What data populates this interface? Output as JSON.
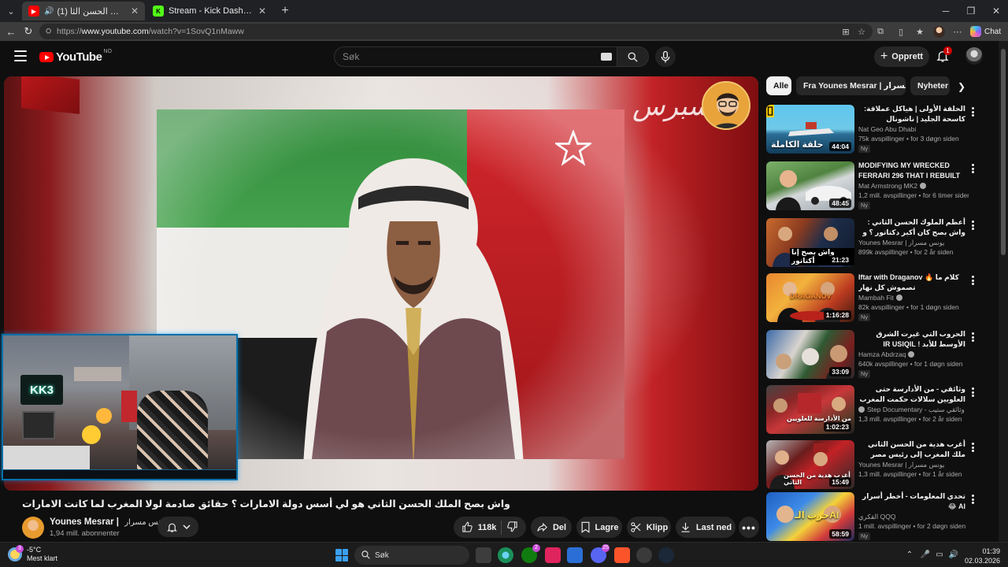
{
  "browser": {
    "tabs": [
      {
        "title": "(1) واش بصح الملك الحسن الثا...",
        "active": true
      },
      {
        "title": "Stream - Kick Dashboard",
        "active": false
      }
    ],
    "url_prefix": "https://",
    "url_host": "www.youtube.com",
    "url_path": "/watch?v=1SovQ1nMaww",
    "copilot_label": "Chat"
  },
  "header": {
    "logo_text": "YouTube",
    "region": "NO",
    "search_placeholder": "Søk",
    "create_label": "Opprett",
    "notification_count": "1"
  },
  "player": {
    "channel_watermark": "سبرس",
    "webcam_sign": "KK3"
  },
  "video": {
    "title": "واش بصح الملك الحسن الثاني هو لي أسس دولة الامارات ؟ حقائق صادمة لولا المغرب لما كانت الامارات",
    "channel_name": "Younes Mesrar |",
    "channel_name_ar": "يونس مسرار",
    "subscribers": "1,94 mill. abonnenter",
    "likes": "118k",
    "share_label": "Del",
    "save_label": "Lagre",
    "clip_label": "Klipp",
    "download_label": "Last ned"
  },
  "chips": [
    "Alle",
    "Fra Younes Mesrar | يونس مسرار",
    "Nyheter fr"
  ],
  "recommendations": [
    {
      "title": "الحلقة الأولى | هياكل عملاقة: كاسحة الجليد | ناشونال جيوغرافيك أبوظبي",
      "channel": "Nat Geo Abu Dhabi",
      "meta": "75k avspillinger • for 3 døgn siden",
      "duration": "44:04",
      "new": "Ny",
      "overlay": "حلقة الكاملة"
    },
    {
      "title": "MODIFYING MY WRECKED FERRARI 296 THAT I REBUILT",
      "channel": "Mat Armstrong MK2",
      "meta": "1,2 mill. avspillinger • for 6 timer siden",
      "duration": "48:45",
      "new": "Ny",
      "overlay": ""
    },
    {
      "title": "أعظم الملوك الحسن الثاني : واش بصح كان أكبر دكتاتور ؟ و علاش بقاي كيحكم ؟",
      "channel": "Younes Mesrar | يونس مسرار",
      "meta": "899k avspillinger • for 2 år siden",
      "duration": "21:23",
      "new": "",
      "overlay": "واش بصح إنا أكتاتور"
    },
    {
      "title": "Iftar with Draganov 🔥 كلام ما تصموش كل نهار",
      "channel": "Mambah Fit",
      "meta": "82k avspillinger • for 1 døgn siden",
      "duration": "1:16:28",
      "new": "Ny",
      "overlay": "DRAGANOV"
    },
    {
      "title": "الحروب التي غيرت الشرق الأوسط للأبد ! IR USIQIL",
      "channel": "Hamza Abdrzaq",
      "meta": "640k avspillinger • for 1 døgn siden",
      "duration": "33:09",
      "new": "Ny",
      "overlay": ""
    },
    {
      "title": "وثائقي - من الأدارسة حتى العلويين سلالات حكمت المغرب",
      "channel": "Step Documentary - وثائقي ستيب",
      "meta": "1,3 mill. avspillinger • for 2 år siden",
      "duration": "1:02:23",
      "new": "",
      "overlay": "من الأدارسة للعلويين"
    },
    {
      "title": "أغرب هدية من الحسن الثاني ملك المغرب إلى رئيس مصر جمال عبد الناصر جعلته يفقد ...",
      "channel": "Younes Mesrar | يونس مسرار",
      "meta": "1,3 mill. avspillinger • for 1 år siden",
      "duration": "15:49",
      "new": "",
      "overlay": "أغرب هدية من الحسن الثاني"
    },
    {
      "title": "تحدي المعلومات - أخطر أسرار AI 😂",
      "channel": "القكري QQQ",
      "meta": "1 mill. avspillinger • for 2 døgn siden",
      "duration": "58:59",
      "new": "Ny",
      "overlay": "حرب الـAI"
    }
  ],
  "taskbar": {
    "temperature": "-5°C",
    "weather_desc": "Mest klart",
    "weather_badge": "3",
    "search_label": "Søk",
    "time": "01:39",
    "date": "02.03.2026",
    "xbox_badge": "2",
    "discord_badge": "25"
  },
  "colors": {
    "background": "#0f0f0f",
    "yt_red": "#ff0000",
    "chip_bg": "#272727",
    "text_primary": "#f1f1f1",
    "text_secondary": "#aaaaaa"
  }
}
